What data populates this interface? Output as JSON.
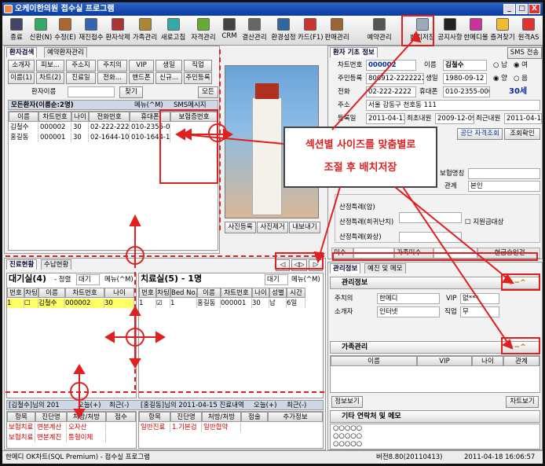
{
  "window": {
    "title": "오케이한의원 접수실 프로그램",
    "min": "_",
    "max": "□",
    "close": "X"
  },
  "toolbar": {
    "items": [
      "종료",
      "신환(N)",
      "수정(E)",
      "재진접수",
      "환자삭제",
      "가족관리",
      "새로고침",
      "자격관리",
      "CRM",
      "결산관리",
      "환경설정",
      "카드(F1)",
      "판매관리",
      "예약관리",
      "배치저장",
      "공지사항",
      "한메디몰",
      "즐겨찾기",
      "원격AS"
    ]
  },
  "patient_search": {
    "tabs": [
      "환자검색",
      "예약환자관리"
    ],
    "filter_row1": [
      "소개자",
      "피보...",
      "주소지",
      "주치의",
      "VIP",
      "생일",
      "직업"
    ],
    "filter_row2": [
      "이름(1)",
      "차트(2)",
      "진료일",
      "전화...",
      "핸드폰",
      "신규...",
      "주민등록"
    ],
    "name_label": "환자이름",
    "find_btn": "찾기",
    "more_btn": "모든",
    "list_title": "모든환자(이름순:2명)",
    "menu_btn": "메뉴(^M)",
    "sms_label": "SMS메시지",
    "columns": [
      "이름",
      "차트번호",
      "나이",
      "전화번호",
      "휴대폰",
      "보험증번호"
    ],
    "rows": [
      [
        "김철수",
        "000002",
        "30",
        "02-222-2222",
        "010-2355-000"
      ],
      [
        "홍길동",
        "000001",
        "30",
        "02-1644-1004",
        "010-1644-10"
      ]
    ],
    "photo_btns": [
      "사진등록",
      "사진제거",
      "내보내기"
    ]
  },
  "patient_info": {
    "tab": "환자 기초 정보",
    "sms_btn": "SMS 전송",
    "chart_no_label": "차트번호",
    "chart_no": "000002",
    "name_label": "이름",
    "name": "김철수",
    "gender_m": "남",
    "gender_f": "여",
    "rrn_label": "주민등록",
    "rrn": "800912-2222222",
    "birth_label": "생일",
    "birth": "1980-09-12",
    "cal_solar": "양",
    "cal_lunar": "음",
    "phone_label": "전화",
    "phone": "02-222-2222",
    "mobile_label": "휴대폰",
    "mobile": "010-2355-0000",
    "age": "30세",
    "addr_label": "주소",
    "addr": "서울 강동구 천호동 111",
    "reg_label": "등록일",
    "reg_date": "2011-04-13",
    "first_label": "최초내원",
    "first_date": "2009-12-09",
    "last_label": "최근내원",
    "last_date": "2011-04-14",
    "gongdan_btn": "공단 자격조회",
    "jogi_btn": "조회확인",
    "ins_name_label": "보험명칭",
    "relation_label": "관계",
    "relation": "본인",
    "sanjeong1": "산정특례(암)",
    "sanjeong2": "산정특례(희귀난치)",
    "support_label": "지원금대상",
    "sanjeong3": "산정특례(화상)",
    "misu_label": "미수",
    "family_misu_label": "가족미수",
    "cash_label": "현금승인건"
  },
  "annotation": {
    "line1": "섹션별 사이즈를 맞춤별로",
    "line2": "조절 후 배치저장"
  },
  "treatment": {
    "tabs": [
      "진료현황",
      "수납현황"
    ],
    "waiting_title": "대기실(4)",
    "sort_label": "- 정렬",
    "sort_value": "대기",
    "menu": "메뉴(^M)",
    "waiting_cols": [
      "번호",
      "차팅",
      "이름",
      "차트번호",
      "나이"
    ],
    "waiting_rows": [
      [
        "1",
        "김철수",
        "000002",
        "30"
      ]
    ],
    "room_title": "치료실(5) - 1명",
    "room_sort": "대기",
    "room_menu": "메뉴(^M)",
    "room_cols": [
      "번호",
      "차팅",
      "Bed No.",
      "이름",
      "차트번호",
      "나이",
      "성별",
      "시간"
    ],
    "room_rows": [
      [
        "1",
        "1",
        "홍길동",
        "000001",
        "30",
        "남",
        "6일"
      ]
    ],
    "hist_left_title": "[김철수]님의 201",
    "hist_right_title": "[홍길동]님의 2011-04-15 진료내역",
    "opt_today": "오늘(+)",
    "opt_recent": "최근(-)",
    "hist_cols": [
      "항목",
      "진단명",
      "처방/처방",
      "점수"
    ],
    "hist_cols_r": [
      "항목",
      "진단명",
      "처방/처방",
      "점술",
      "추가정보"
    ],
    "hist_left_rows": [
      [
        "보험치료",
        "변분계산",
        "오자산"
      ],
      [
        "보험치료",
        "변분계진",
        "통혈이체"
      ]
    ],
    "hist_right_rows": [
      [
        "일반진료",
        "1.기본검",
        "일반협약"
      ]
    ]
  },
  "manage": {
    "tabs": [
      "관리정보",
      "예진 및 메모"
    ],
    "sec1": "관리정보",
    "doctor_label": "주치의",
    "doctor": "한메디",
    "vip_label": "VIP",
    "vip": "없***",
    "intro_label": "소개자",
    "intro": "인터넷",
    "job_label": "직업",
    "job": "무",
    "sec2": "가족관리",
    "family_cols": [
      "이름",
      "VIP",
      "나이",
      "관계"
    ],
    "info_btn": "정보보기",
    "chart_btn": "차트보기",
    "sec3": "기타 연락처 및 메모",
    "memo_lines": [
      "○○○○○",
      "○○○○○",
      "○○○○○"
    ]
  },
  "statusbar": {
    "app": "한메디 OK차트(SQL Premium) - 접수실 프로그램",
    "version": "버전8.80(20110413)",
    "datetime": "2011-04-18 16:06:57"
  },
  "colors": {
    "accent": "#e02020",
    "title": "#0b3b9c",
    "highlight": "#ffff66"
  }
}
